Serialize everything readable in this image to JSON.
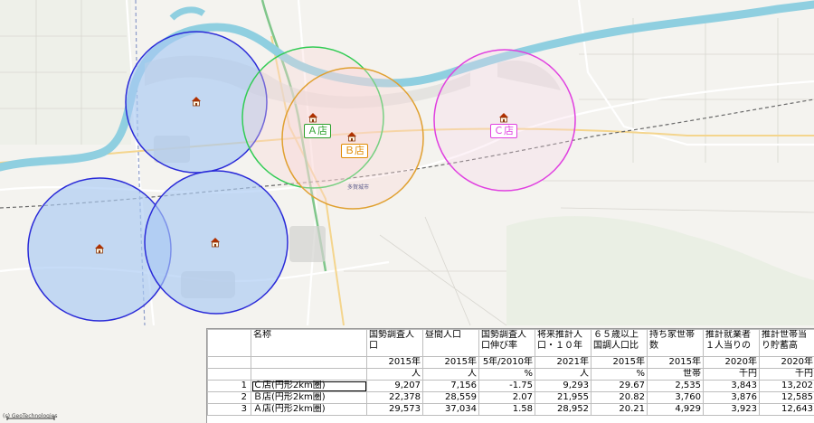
{
  "map": {
    "attribution": "(c) GeoTechnologies",
    "stores": [
      {
        "label": "Ａ店",
        "color": "#2ca02c"
      },
      {
        "label": "Ｂ店",
        "color": "#e08a00"
      },
      {
        "label": "Ｃ店",
        "color": "#e040e0"
      }
    ],
    "area_label": "多賀城市",
    "circle_colors": {
      "blue_fill": "#a9c9f2",
      "blue_stroke": "#2a2ad8",
      "green": "#33cc55",
      "orange": "#e0a030",
      "magenta": "#e040e0"
    }
  },
  "table": {
    "headers": [
      {
        "title": "",
        "unit1": "",
        "unit2": ""
      },
      {
        "title": "名称",
        "unit1": "",
        "unit2": ""
      },
      {
        "title": "国勢調査人口",
        "unit1": "2015年",
        "unit2": "人"
      },
      {
        "title": "昼間人口",
        "unit1": "2015年",
        "unit2": "人"
      },
      {
        "title": "国勢調査人口伸び率",
        "unit1": "5年/2010年",
        "unit2": "%"
      },
      {
        "title": "将来推計人口・１０年",
        "unit1": "2021年",
        "unit2": "人"
      },
      {
        "title": "６５歳以上国調人口比",
        "unit1": "2015年",
        "unit2": "%"
      },
      {
        "title": "持ち家世帯数",
        "unit1": "2015年",
        "unit2": "世帯"
      },
      {
        "title": "推計就業者１人当りの",
        "unit1": "2020年",
        "unit2": "千円"
      },
      {
        "title": "推計世帯当り貯蓄高",
        "unit1": "2020年",
        "unit2": "千円"
      }
    ],
    "rows": [
      {
        "idx": "1",
        "name": "Ｃ店(円形2km圏)",
        "c1": "9,207",
        "c2": "7,156",
        "c3": "-1.75",
        "c4": "9,293",
        "c5": "29.67",
        "c6": "2,535",
        "c7": "3,843",
        "c8": "13,202"
      },
      {
        "idx": "2",
        "name": "Ｂ店(円形2km圏)",
        "c1": "22,378",
        "c2": "28,559",
        "c3": "2.07",
        "c4": "21,955",
        "c5": "20.82",
        "c6": "3,760",
        "c7": "3,876",
        "c8": "12,585"
      },
      {
        "idx": "3",
        "name": "Ａ店(円形2km圏)",
        "c1": "29,573",
        "c2": "37,034",
        "c3": "1.58",
        "c4": "28,952",
        "c5": "20.21",
        "c6": "4,929",
        "c7": "3,923",
        "c8": "12,643"
      }
    ]
  }
}
